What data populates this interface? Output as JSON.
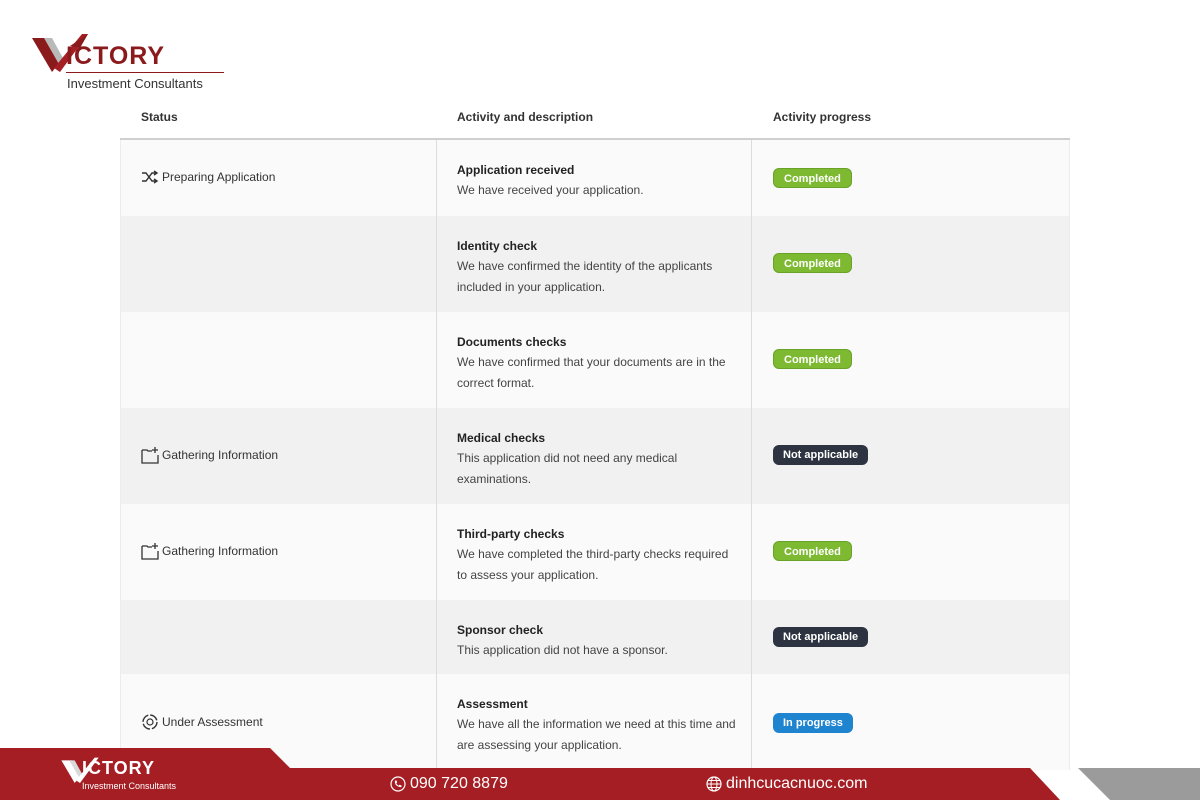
{
  "brand": {
    "name": "ICTORY",
    "tagline": "Investment Consultants"
  },
  "table": {
    "headers": {
      "status": "Status",
      "activity": "Activity and description",
      "progress": "Activity progress"
    },
    "rows": [
      {
        "status": "Preparing Application",
        "status_icon": "shuffle-icon",
        "title": "Application received",
        "desc": "We have received your application.",
        "progress": "Completed"
      },
      {
        "status": "",
        "status_icon": "",
        "title": "Identity check",
        "desc": "We have confirmed the identity of the applicants included in your application.",
        "progress": "Completed"
      },
      {
        "status": "",
        "status_icon": "",
        "title": "Documents checks",
        "desc": "We have confirmed that your documents are in the correct format.",
        "progress": "Completed"
      },
      {
        "status": "Gathering Information",
        "status_icon": "folder-add-icon",
        "title": "Medical checks",
        "desc": "This application did not need any medical examinations.",
        "progress": "Not applicable"
      },
      {
        "status": "Gathering Information",
        "status_icon": "folder-add-icon",
        "title": "Third-party checks",
        "desc": "We have completed the third-party checks required to assess your application.",
        "progress": "Completed"
      },
      {
        "status": "",
        "status_icon": "",
        "title": "Sponsor check",
        "desc": "This application did not have a sponsor.",
        "progress": "Not applicable"
      },
      {
        "status": "Under Assessment",
        "status_icon": "assessment-cycle-icon",
        "title": "Assessment",
        "desc": "We have all the information we need at this time and are assessing your application.",
        "progress": "In progress"
      }
    ]
  },
  "footer": {
    "phone": "090 720 8879",
    "website": "dinhcucacnuoc.com"
  },
  "colors": {
    "brand_red": "#a51e24",
    "completed": "#7dba31",
    "not_applicable": "#2d3340",
    "in_progress": "#1f84d0"
  }
}
